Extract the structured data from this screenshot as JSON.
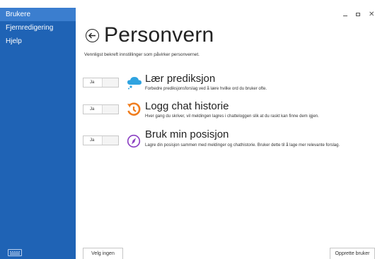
{
  "sidebar": {
    "items": [
      {
        "label": "Brukere"
      },
      {
        "label": "Fjernredigering"
      },
      {
        "label": "Hjelp"
      }
    ]
  },
  "header": {
    "title": "Personvern",
    "subtitle": "Vennligst bekreft innstillinger som påvirker personvernet."
  },
  "settings": [
    {
      "toggle_label": "Ja",
      "icon": "cloud-icon",
      "title": "Lær prediksjon",
      "description": "Forbedre prediksjonsforslag ved å lære hvilke ord du bruker ofte."
    },
    {
      "toggle_label": "Ja",
      "icon": "history-icon",
      "title": "Logg chat historie",
      "description": "Hver gang du skriver, vil meldingen lagres i chatteloggen slik at du raskt kan finne dem igjen."
    },
    {
      "toggle_label": "Ja",
      "icon": "compass-icon",
      "title": "Bruk min posisjon",
      "description": "Lagre din posisjon sammen med meldinger og chathistorie. Bruker dette til å lage mer relevante forslag."
    }
  ],
  "footer": {
    "left_button": "Velg ingen",
    "right_button": "Opprette bruker"
  },
  "colors": {
    "sidebar": "#1f63b5",
    "sidebar_active": "#3b7ecf",
    "cloud": "#2fa3e0",
    "history": "#f07d1e",
    "compass": "#8a3ec2"
  }
}
